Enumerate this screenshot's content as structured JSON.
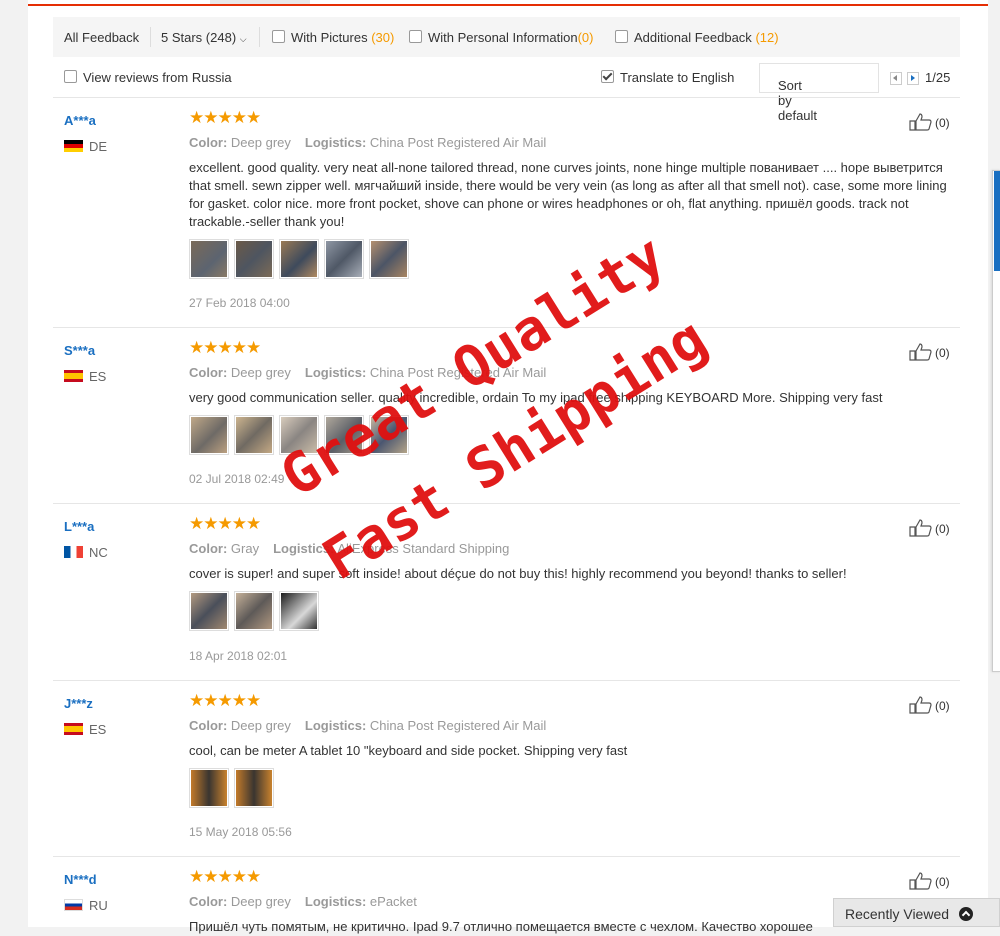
{
  "filters": {
    "all_feedback": "All Feedback",
    "stars": "5 Stars (248)",
    "with_pictures_label": "With Pictures",
    "with_pictures_count": "(30)",
    "personal_info_label": "With Personal Information",
    "personal_info_count": "(0)",
    "additional_label": "Additional Feedback",
    "additional_count": "(12)",
    "view_russia": "View reviews from Russia",
    "translate": "Translate to English",
    "sort": "Sort by default",
    "page": "1/25"
  },
  "labels": {
    "color": "Color:",
    "logistics": "Logistics:"
  },
  "reviews": [
    {
      "user": "A***a",
      "country": "DE",
      "stars": "★★★★★",
      "color": "Deep grey",
      "logistics": "China Post Registered Air Mail",
      "text": "excellent. good quality. very neat all-none tailored thread, none curves joints, none hinge multiple пованивает .... hope выветрится that smell. sewn zipper well. мягчайший inside, there would be very vein (as long as after all that smell not). case, some more lining for gasket. color nice. more front pocket, shove can phone or wires headphones or oh, flat anything. пришёл goods. track not trackable.-seller thank you!",
      "date": "27 Feb 2018 04:00",
      "likes": "(0)"
    },
    {
      "user": "S***a",
      "country": "ES",
      "stars": "★★★★★",
      "color": "Deep grey",
      "logistics": "China Post Registered Air Mail",
      "text": "very good communication seller. quality incredible, ordain To my ipad free shipping KEYBOARD More. Shipping very fast",
      "date": "02 Jul 2018 02:49",
      "likes": "(0)"
    },
    {
      "user": "L***a",
      "country": "NC",
      "stars": "★★★★★",
      "color": "Gray",
      "logistics": "AliExpress Standard Shipping",
      "text": "cover is super! and super soft inside! about déçue do not buy this! highly recommend you beyond! thanks to seller!",
      "date": "18 Apr 2018 02:01",
      "likes": "(0)"
    },
    {
      "user": "J***z",
      "country": "ES",
      "stars": "★★★★★",
      "color": "Deep grey",
      "logistics": "China Post Registered Air Mail",
      "text": "cool, can be meter A tablet 10 \"keyboard and side pocket. Shipping very fast",
      "date": "15 May 2018 05:56",
      "likes": "(0)"
    },
    {
      "user": "N***d",
      "country": "RU",
      "stars": "★★★★★",
      "color": "Deep grey",
      "logistics": "ePacket",
      "text": "Пришёл чуть помятым, не критично. Ipad 9.7 отлично помещается вместе с чехлом. Качество хорошее",
      "date": "",
      "likes": "(0)"
    }
  ],
  "watermark": {
    "line1": "Great Quality",
    "line2": "Fast Shipping"
  },
  "recently_viewed": "Recently Viewed",
  "icons": {
    "like": "thumbs-up-icon",
    "dropdown": "chevron-down-icon",
    "prev": "caret-left-icon",
    "next": "caret-right-icon",
    "recent_toggle": "chevron-up-circle-icon"
  },
  "colors": {
    "accent": "#e52e04",
    "link": "#1a6fc1",
    "star": "#f59a00",
    "count": "#f59a00",
    "watermark": "#e01010"
  }
}
